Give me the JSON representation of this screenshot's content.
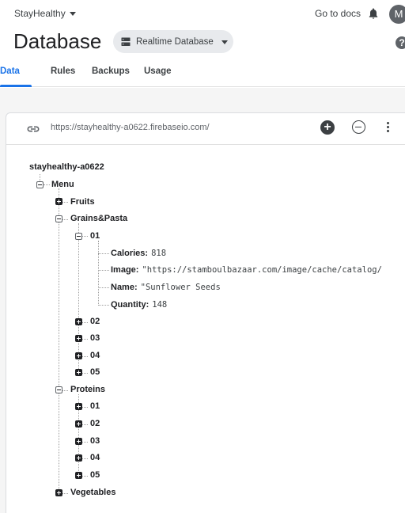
{
  "topbar": {
    "project_name": "StayHealthy",
    "docs_label": "Go to docs",
    "avatar_initial": "M"
  },
  "header": {
    "title": "Database",
    "db_selector_label": "Realtime Database",
    "help_glyph": "?"
  },
  "tabs": [
    {
      "label": "Data",
      "active": true
    },
    {
      "label": "Rules",
      "active": false
    },
    {
      "label": "Backups",
      "active": false
    },
    {
      "label": "Usage",
      "active": false
    }
  ],
  "urlbar": {
    "url": "https://stayhealthy-a0622.firebaseio.com/"
  },
  "tree": {
    "root": "stayhealthy-a0622",
    "menu": "Menu",
    "fruits": "Fruits",
    "grains": "Grains&Pasta",
    "grains_01": "01",
    "fields": [
      {
        "key": "Calories:",
        "value": "818"
      },
      {
        "key": "Image:",
        "value": "\"https://stamboulbazaar.com/image/cache/catalog/"
      },
      {
        "key": "Name:",
        "value": "\"Sunflower Seeds"
      },
      {
        "key": "Quantity:",
        "value": "148"
      }
    ],
    "grains_rest": [
      "02",
      "03",
      "04",
      "05"
    ],
    "proteins": "Proteins",
    "proteins_items": [
      "01",
      "02",
      "03",
      "04",
      "05"
    ],
    "vegetables": "Vegetables"
  },
  "colors": {
    "accent": "#1a73e8",
    "text": "#202124",
    "muted": "#5f6368"
  }
}
